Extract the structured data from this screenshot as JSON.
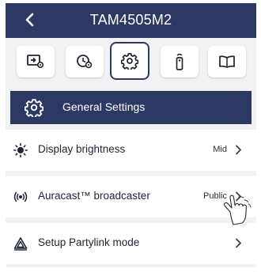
{
  "header": {
    "title": "TAM4505M2",
    "back_icon": "back-chevron-icon"
  },
  "tabs": [
    {
      "icon": "input-settings-icon",
      "active": false
    },
    {
      "icon": "timer-settings-icon",
      "active": false
    },
    {
      "icon": "settings-gear-icon",
      "active": true
    },
    {
      "icon": "remote-control-icon",
      "active": false
    },
    {
      "icon": "manual-book-icon",
      "active": false
    }
  ],
  "section": {
    "icon": "settings-gear-icon",
    "label": "General Settings"
  },
  "rows": [
    {
      "icon": "brightness-icon",
      "label": "Display brightness",
      "value": "Mid"
    },
    {
      "icon": "broadcast-icon",
      "label": "Auracast™ broadcaster",
      "value": "Public"
    },
    {
      "icon": "partylink-icon",
      "label": "Setup Partylink mode",
      "value": ""
    }
  ],
  "colors": {
    "navy": "#2c3a63",
    "background": "#f2f2f4"
  }
}
